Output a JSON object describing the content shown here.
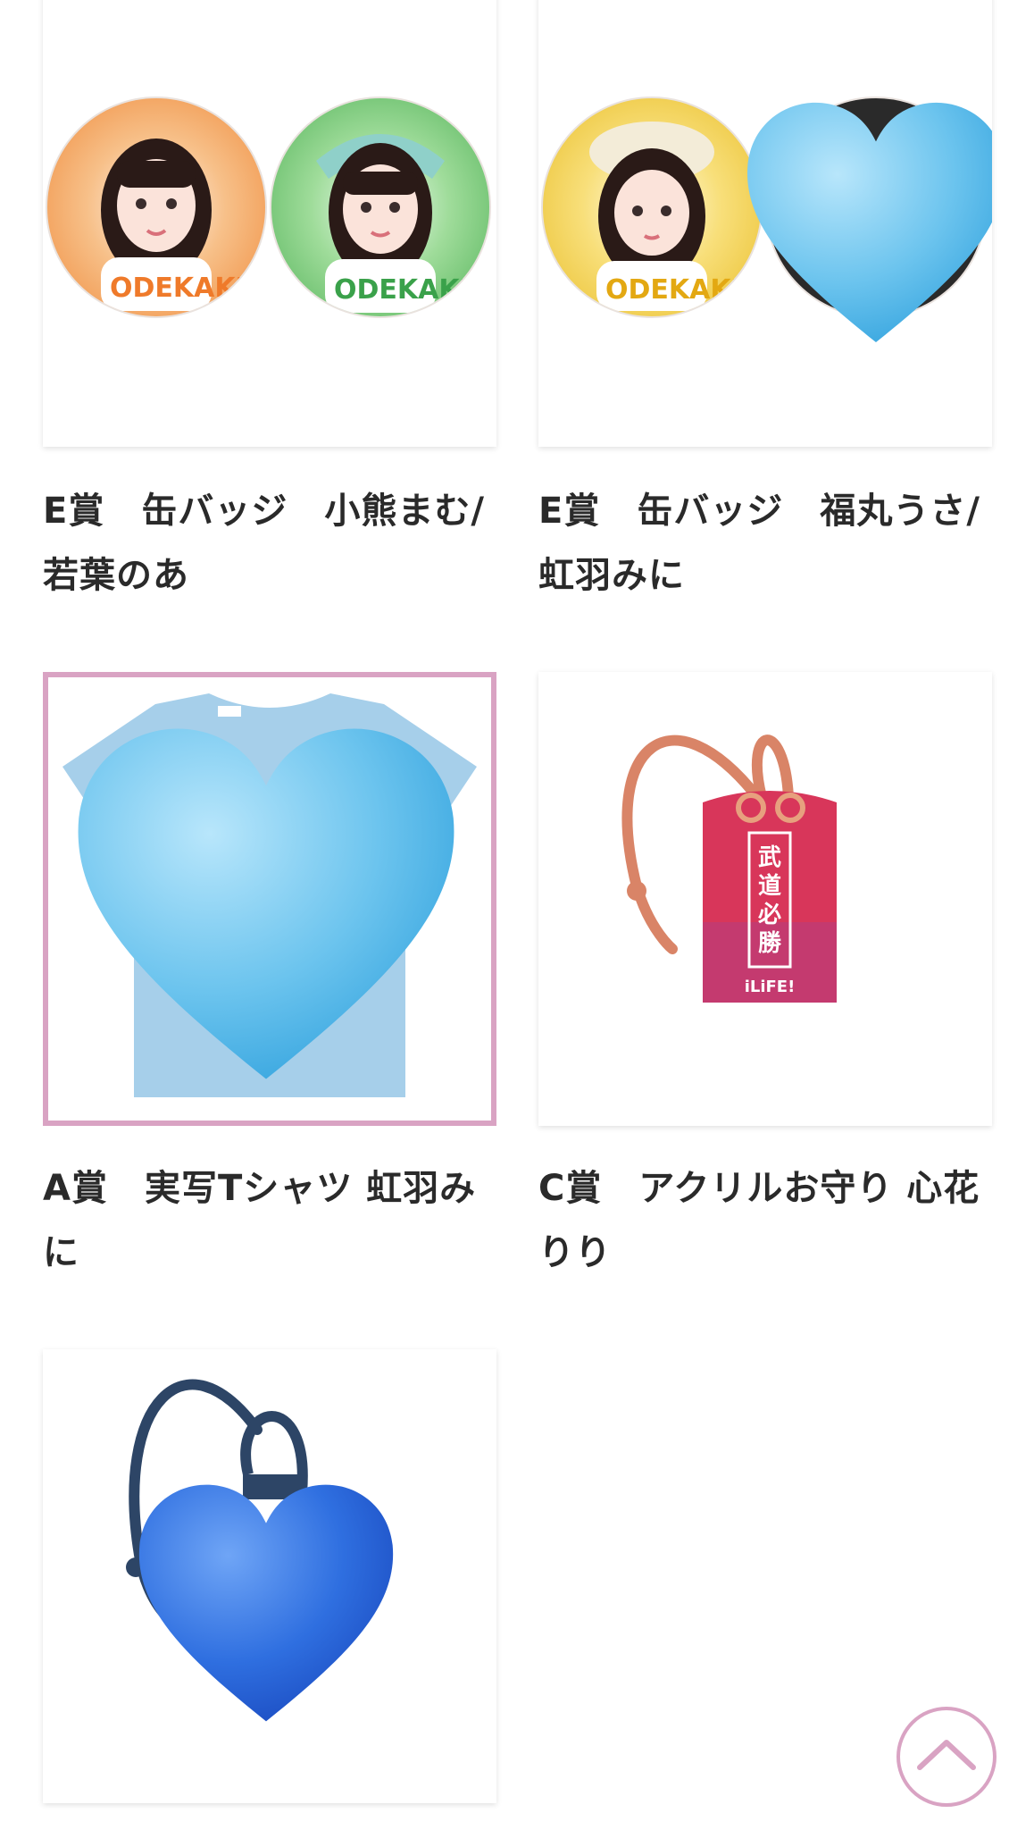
{
  "products": [
    {
      "title": "E賞　缶バッジ　小熊まむ/若葉のあ",
      "image": "two-can-badges-orange-green"
    },
    {
      "title": "E賞　缶バッジ　福丸うさ/虹羽みに",
      "image": "two-can-badges-yellow-covered-by-heart",
      "selected": false
    },
    {
      "title": "A賞　実写Tシャツ 虹羽みに",
      "image": "light-blue-tshirt-covered-by-heart",
      "selected": true
    },
    {
      "title": "C賞　アクリルお守り 心花りり",
      "image": "red-acrylic-omamori-charm"
    },
    {
      "title": "",
      "image": "navy-acrylic-omamori-covered-by-heart"
    }
  ],
  "charm": {
    "line1": "武道必勝",
    "brand": "iLiFE!"
  },
  "badge_logo": "ODEKAKE!",
  "colors": {
    "accent_pink": "#d9a3c3",
    "heart_light_blue": "#6cc4ee",
    "heart_blue": "#2f6fe0"
  },
  "scroll_top": {
    "icon": "chevron-up-icon",
    "label": "Scroll to top"
  }
}
